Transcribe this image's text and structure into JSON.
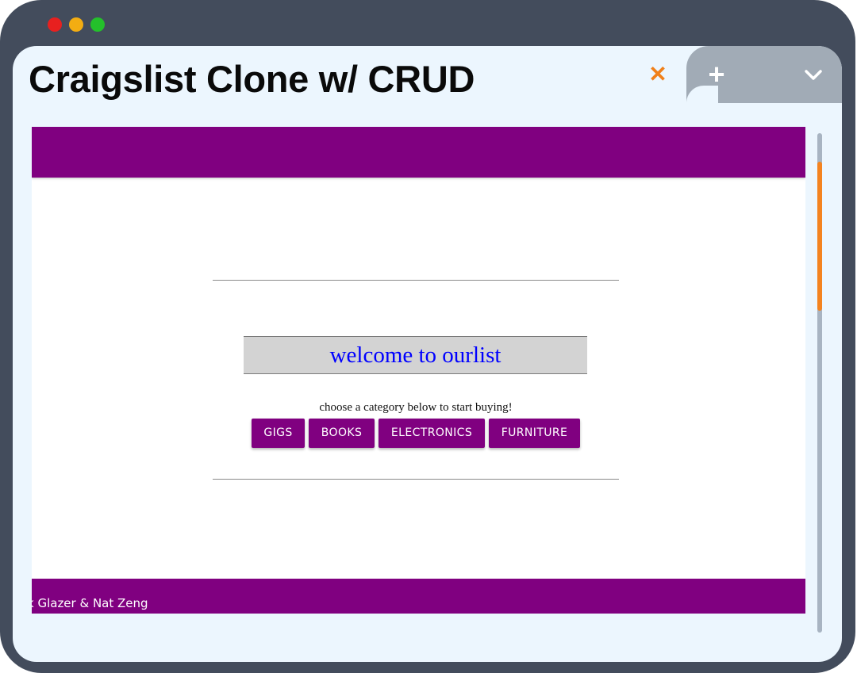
{
  "window": {
    "title": "Craigslist Clone w/ CRUD",
    "controls": {
      "close_glyph": "✕",
      "new_tab_glyph": "+",
      "menu_icon": "chevron-down-icon"
    },
    "colors": {
      "chrome": "#434c5c",
      "close_accent": "#f0801a",
      "scrollbar_thumb": "#f4831f"
    }
  },
  "site": {
    "brand_color": "#800080",
    "welcome": "welcome to ourlist",
    "tagline": "choose a category below to start buying!",
    "categories": [
      "GIGS",
      "BOOKS",
      "ELECTRONICS",
      "FURNITURE"
    ],
    "footer_credit": "k Glazer & Nat Zeng"
  }
}
